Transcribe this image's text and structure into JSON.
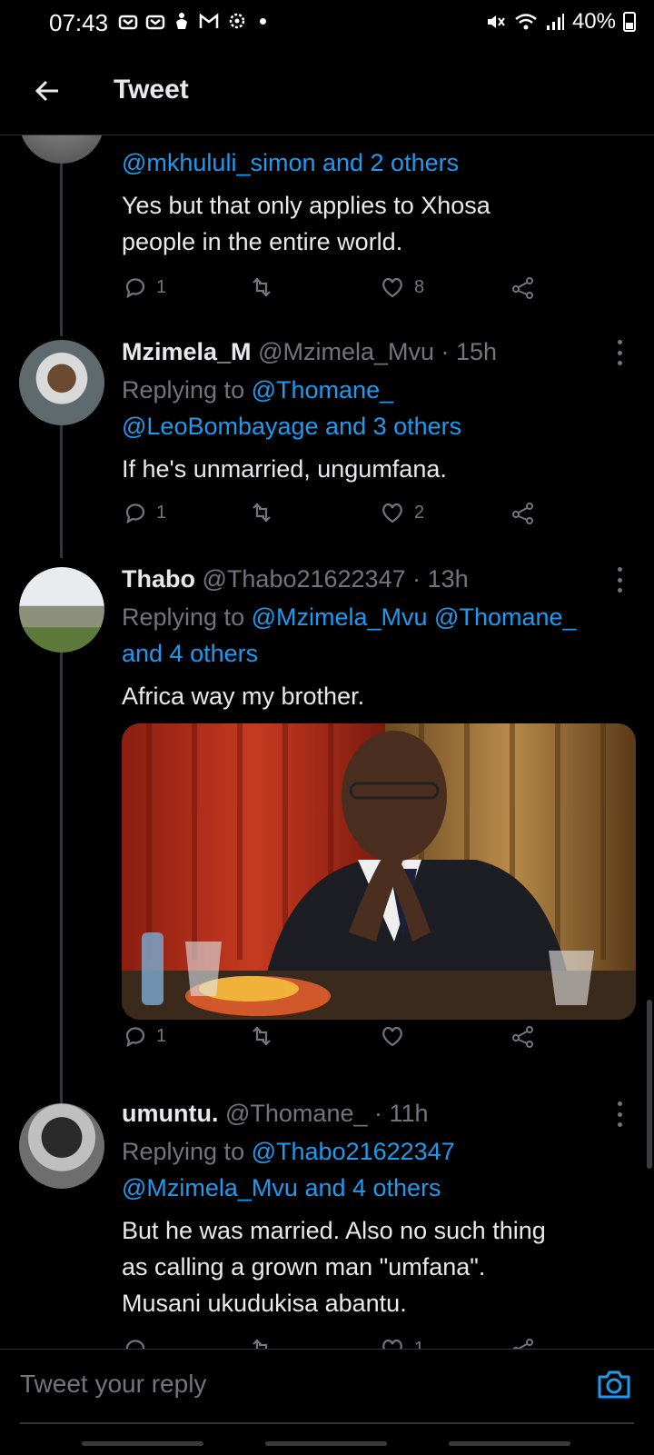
{
  "status_bar": {
    "time": "07:43",
    "battery": "40%",
    "left_icons": [
      "mail-icon",
      "mail-icon",
      "hand-icon",
      "gmail-icon",
      "settings-icon",
      "dot-icon"
    ],
    "right_icons": [
      "mute-icon",
      "wifi-icon",
      "signal-icon",
      "battery-icon"
    ]
  },
  "header": {
    "title": "Tweet"
  },
  "tweets": [
    {
      "replying_link": "@mkhululi_simon and 2 others",
      "text_lines": [
        "Yes but that only applies to Xhosa",
        "people in the entire world."
      ],
      "replies": "1",
      "retweets": "",
      "likes": "8"
    },
    {
      "name": "Mzimela_M",
      "handle": "@Mzimela_Mvu · 15h",
      "replying_prefix": "Replying to",
      "replying_line1": "@Thomane_",
      "replying_line2": "@LeoBombayage and 3 others",
      "text_lines": [
        "If he's unmarried, ungumfana."
      ],
      "replies": "1",
      "retweets": "",
      "likes": "2"
    },
    {
      "name": "Thabo",
      "handle": "@Thabo21622347 · 13h",
      "replying_prefix": "Replying to",
      "replying_line1": "@Mzimela_Mvu @Thomane_",
      "replying_line2": "and 4 others",
      "text_lines": [
        "Africa way my brother."
      ],
      "replies": "1",
      "retweets": "",
      "likes": ""
    },
    {
      "name": "umuntu.",
      "handle": "@Thomane_ · 11h",
      "replying_prefix": "Replying to",
      "replying_line1": "@Thabo21622347",
      "replying_line2": "@Mzimela_Mvu and 4 others",
      "text_lines": [
        "But he was married. Also no such thing",
        "as calling a grown man \"umfana\".",
        "Musani ukudukisa abantu."
      ],
      "likes": "1"
    }
  ],
  "reply_box": {
    "placeholder": "Tweet your reply"
  },
  "colors": {
    "accent": "#1d9bf0",
    "muted": "#71767b",
    "background": "#000000"
  }
}
